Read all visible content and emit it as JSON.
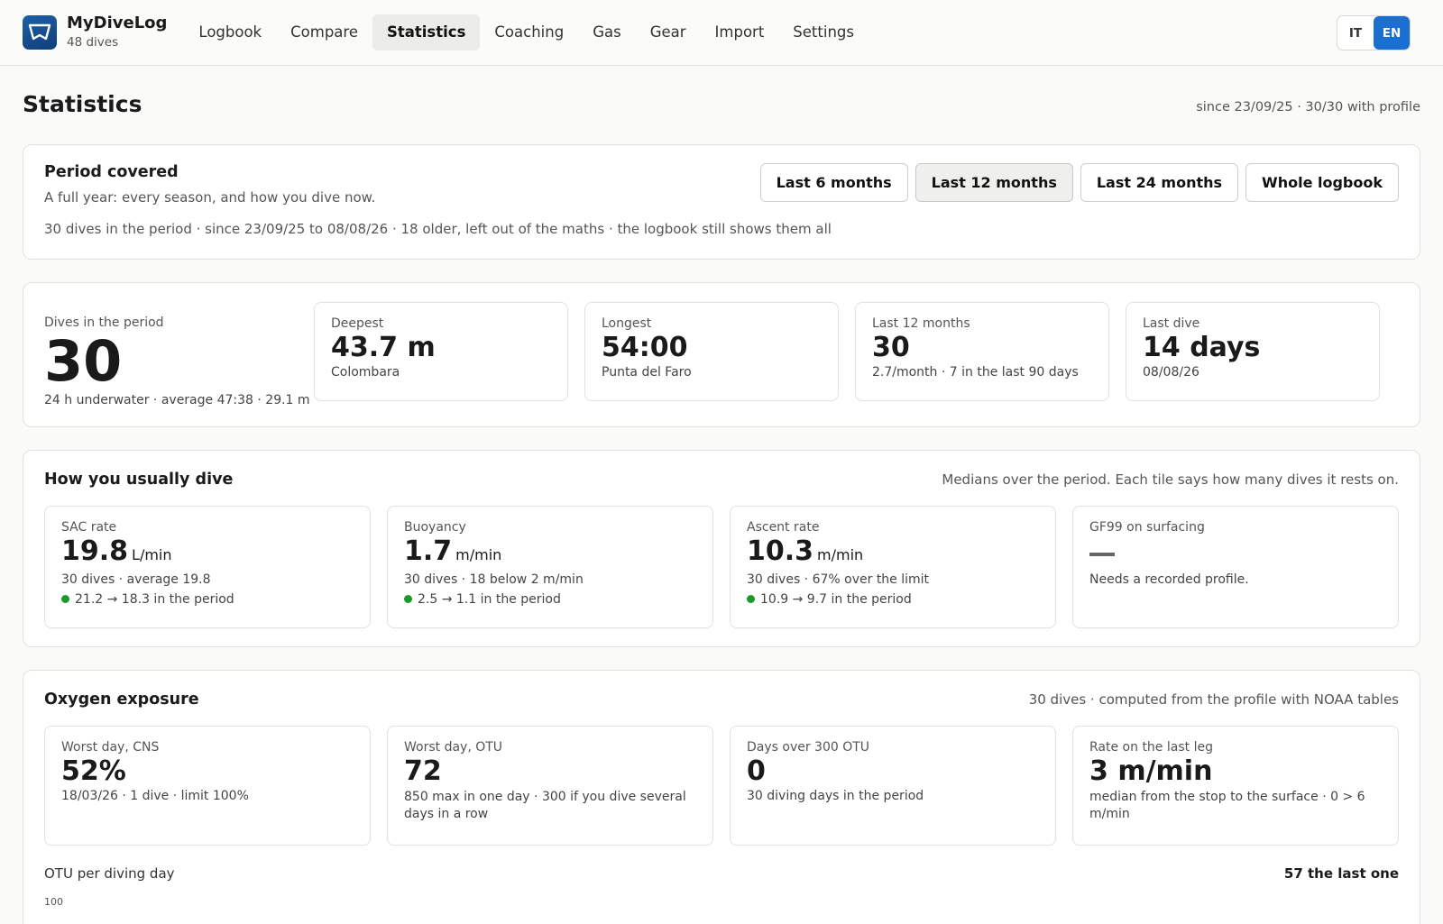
{
  "app": {
    "name": "MyDiveLog",
    "dive_count": "48 dives"
  },
  "nav": [
    {
      "label": "Logbook",
      "active": false
    },
    {
      "label": "Compare",
      "active": false
    },
    {
      "label": "Statistics",
      "active": true
    },
    {
      "label": "Coaching",
      "active": false
    },
    {
      "label": "Gas",
      "active": false
    },
    {
      "label": "Gear",
      "active": false
    },
    {
      "label": "Import",
      "active": false
    },
    {
      "label": "Settings",
      "active": false
    }
  ],
  "lang": {
    "it": "IT",
    "en": "EN",
    "selected": "EN"
  },
  "page": {
    "title": "Statistics",
    "meta": "since 23/09/25 · 30/30 with profile"
  },
  "period": {
    "title": "Period covered",
    "subtitle": "A full year: every season, and how you dive now.",
    "line": "30 dives in the period · since 23/09/25 to 08/08/26 · 18 older, left out of the maths · the logbook still shows them all",
    "buttons": [
      "Last 6 months",
      "Last 12 months",
      "Last 24 months",
      "Whole logbook"
    ],
    "selected": "Last 12 months"
  },
  "summary": {
    "main": {
      "label": "Dives in the period",
      "value": "30",
      "detail": "24 h underwater · average 47:38 · 29.1 m"
    },
    "tiles": [
      {
        "label": "Deepest",
        "value": "43.7 m",
        "detail": "Colombara"
      },
      {
        "label": "Longest",
        "value": "54:00",
        "detail": "Punta del Faro"
      },
      {
        "label": "Last 12 months",
        "value": "30",
        "detail": "2.7/month · 7 in the last 90 days"
      },
      {
        "label": "Last dive",
        "value": "14 days",
        "detail": "08/08/26"
      }
    ]
  },
  "usual": {
    "title": "How you usually dive",
    "note": "Medians over the period. Each tile says how many dives it rests on.",
    "tiles": [
      {
        "label": "SAC rate",
        "value": "19.8",
        "unit": "L/min",
        "detail": "30 dives · average 19.8",
        "trend": "21.2 → 18.3 in the period"
      },
      {
        "label": "Buoyancy",
        "value": "1.7",
        "unit": "m/min",
        "detail": "30 dives · 18 below 2 m/min",
        "trend": "2.5 → 1.1 in the period"
      },
      {
        "label": "Ascent rate",
        "value": "10.3",
        "unit": "m/min",
        "detail": "30 dives · 67% over the limit",
        "trend": "10.9 → 9.7 in the period"
      },
      {
        "label": "GF99 on surfacing",
        "detail": "Needs a recorded profile."
      }
    ],
    "trend_color": "#1a9a2a"
  },
  "oxygen": {
    "title": "Oxygen exposure",
    "note": "30 dives · computed from the profile with NOAA tables",
    "tiles": [
      {
        "label": "Worst day, CNS",
        "value": "52%",
        "detail": "18/03/26 · 1 dive · limit 100%"
      },
      {
        "label": "Worst day, OTU",
        "value": "72",
        "detail": "850 max in one day · 300 if you dive several days in a row"
      },
      {
        "label": "Days over 300 OTU",
        "value": "0",
        "detail": "30 diving days in the period"
      },
      {
        "label": "Rate on the last leg",
        "value": "3 m/min",
        "detail": "median from the stop to the surface · 0 > 6 m/min"
      }
    ],
    "otu_label": "OTU per diving day",
    "otu_last": "57 the last one",
    "axis_tick": "100"
  }
}
